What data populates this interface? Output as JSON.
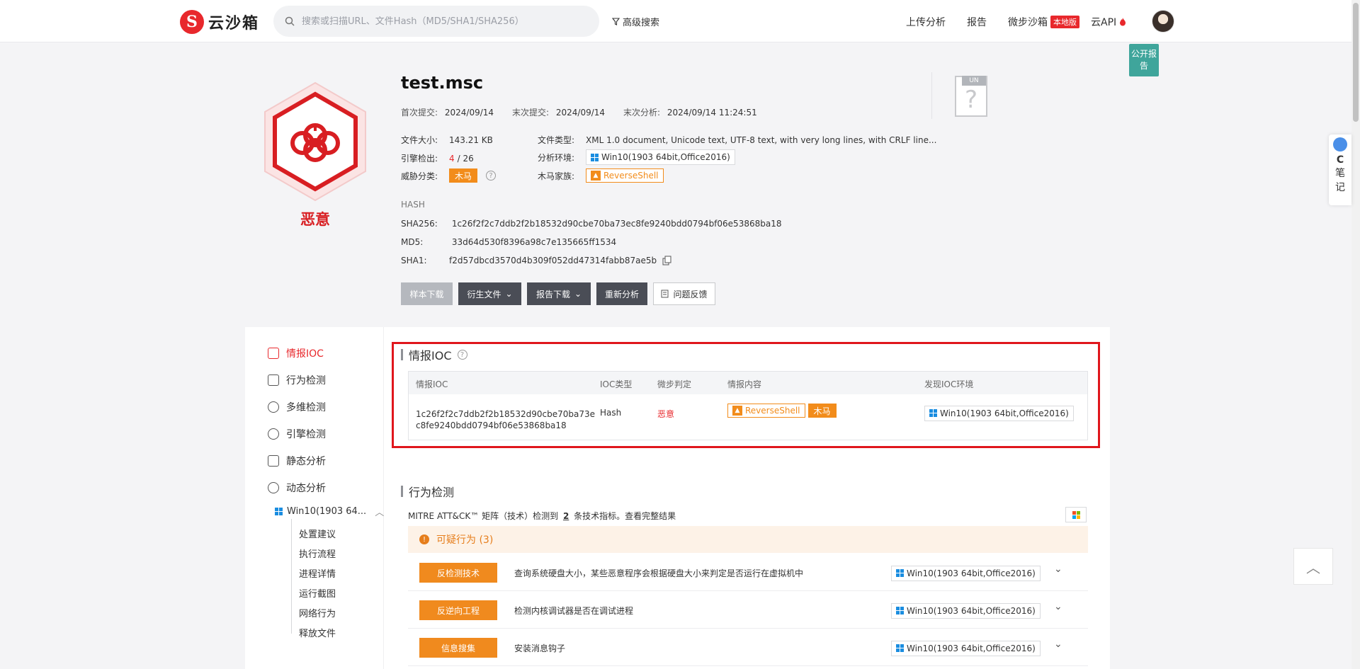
{
  "header": {
    "logo_mark": "S",
    "logo_text": "云沙箱",
    "search_placeholder": "搜索或扫描URL、文件Hash（MD5/SHA1/SHA256）",
    "advanced_search": "高级搜索",
    "nav": [
      "上传分析",
      "报告",
      "微步沙箱",
      "云API"
    ],
    "local_badge": "本地版"
  },
  "public_report_badge": "公开报告",
  "side_note": {
    "label_c": "C",
    "label_1": "笔",
    "label_2": "记"
  },
  "to_top": "︿",
  "file": {
    "name": "test.msc",
    "verdict": "恶意",
    "first_submit_label": "首次提交:",
    "first_submit": "2024/09/14",
    "last_submit_label": "末次提交:",
    "last_submit": "2024/09/14",
    "last_analysis_label": "末次分析:",
    "last_analysis": "2024/09/14 11:24:51",
    "size_label": "文件大小:",
    "size": "143.21 KB",
    "type_label": "文件类型:",
    "type": "XML 1.0 document, Unicode text, UTF-8 text, with very long lines, with CRLF line...",
    "engine_label": "引擎检出:",
    "engine_hits": "4",
    "engine_total": "/ 26",
    "env_label": "分析环境:",
    "env": "Win10(1903 64bit,Office2016)",
    "threat_label": "威胁分类:",
    "threat": "木马",
    "family_label": "木马家族:",
    "family": "ReverseShell",
    "un_tag": "UN",
    "un_q": "?"
  },
  "hash": {
    "title": "HASH",
    "sha256_label": "SHA256:",
    "sha256": "1c26f2f2c7ddb2f2b18532d90cbe70ba73ec8fe9240bdd0794bf06e53868ba18",
    "md5_label": "MD5:",
    "md5": "33d64d530f8396a98c7e135665ff1534",
    "sha1_label": "SHA1:",
    "sha1": "f2d57dbcd3570d4b309f052dd47314fabb87ae5b"
  },
  "actions": {
    "download_sample": "样本下载",
    "derived_files": "衍生文件",
    "report_download": "报告下载",
    "reanalyze": "重新分析",
    "feedback": "问题反馈"
  },
  "left_nav": {
    "items": [
      "情报IOC",
      "行为检测",
      "多维检测",
      "引擎检测",
      "静态分析",
      "动态分析"
    ],
    "env": "Win10(1903 64...",
    "sub_items": [
      "处置建议",
      "执行流程",
      "进程详情",
      "运行截图",
      "网络行为",
      "释放文件"
    ]
  },
  "ioc": {
    "title": "情报IOC",
    "headers": [
      "情报IOC",
      "IOC类型",
      "微步判定",
      "情报内容",
      "发现IOC环境"
    ],
    "row": {
      "ioc_line1": "1c26f2f2c7ddb2f2b18532d90cbe70ba73e",
      "ioc_line2": "c8fe9240bdd0794bf06e53868ba18",
      "type": "Hash",
      "verdict": "恶意",
      "family": "ReverseShell",
      "tag": "木马",
      "env": "Win10(1903 64bit,Office2016)"
    }
  },
  "behavior": {
    "title": "行为检测",
    "mitre_prefix": "MITRE ATT&CK™ 矩阵（技术）检测到",
    "mitre_count": "2",
    "mitre_suffix": "条技术指标。查看完整结果",
    "suspicious_label": "可疑行为 (3)",
    "rows": [
      {
        "tag": "反检测技术",
        "desc": "查询系统硬盘大小，某些恶意程序会根据硬盘大小来判定是否运行在虚拟机中",
        "env": "Win10(1903 64bit,Office2016)"
      },
      {
        "tag": "反逆向工程",
        "desc": "检测内核调试器是否在调试进程",
        "env": "Win10(1903 64bit,Office2016)"
      },
      {
        "tag": "信息搜集",
        "desc": "安装消息钩子",
        "env": "Win10(1903 64bit,Office2016)"
      }
    ]
  }
}
